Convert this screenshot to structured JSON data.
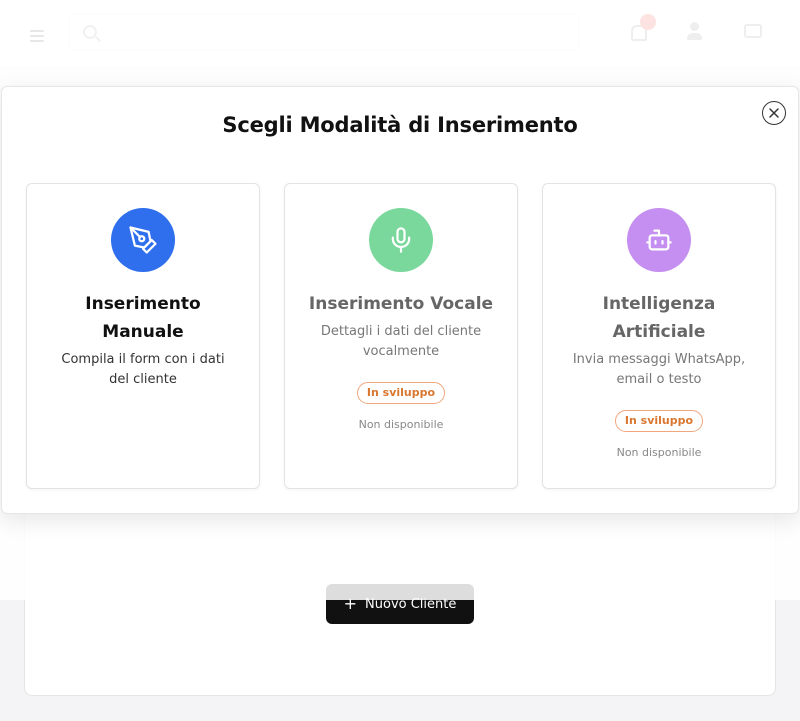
{
  "header": {
    "search_placeholder": "",
    "notification_count": ""
  },
  "background": {
    "empty_title": "",
    "empty_subtitle": "",
    "new_client_label": "Nuovo Cliente"
  },
  "modal": {
    "title": "Scegli Modalità di Inserimento",
    "options": [
      {
        "title": "Inserimento Manuale",
        "description": "Compila il form con i dati del cliente",
        "icon": "pen-icon",
        "color": "#2f6fed"
      },
      {
        "title": "Inserimento Vocale",
        "description": "Dettagli i dati del cliente vocalmente",
        "badge": "In sviluppo",
        "status": "Non disponibile",
        "icon": "microphone-icon",
        "color": "#7bd89c"
      },
      {
        "title": "Intelligenza Artificiale",
        "description": "Invia messaggi WhatsApp, email o testo",
        "badge": "In sviluppo",
        "status": "Non disponibile",
        "icon": "bot-icon",
        "color": "#c48ff0"
      }
    ]
  }
}
